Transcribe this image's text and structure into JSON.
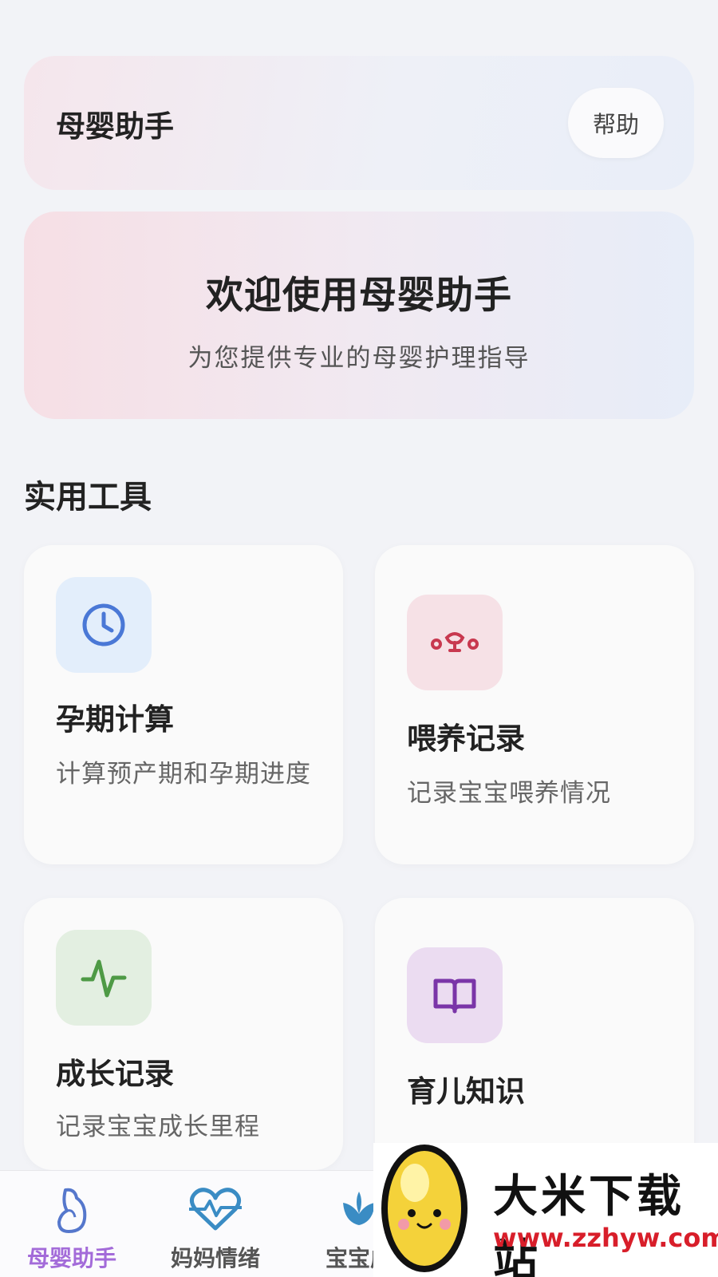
{
  "header": {
    "title": "母婴助手",
    "help_label": "帮助"
  },
  "banner": {
    "title": "欢迎使用母婴助手",
    "subtitle": "为您提供专业的母婴护理指导"
  },
  "tools": {
    "section_title": "实用工具",
    "items": [
      {
        "title": "孕期计算",
        "desc": "计算预产期和孕期进度",
        "icon": "clock-icon",
        "icon_bg": "#e3eefb",
        "icon_color": "#4a78d6"
      },
      {
        "title": "喂养记录",
        "desc": "记录宝宝喂养情况",
        "icon": "feeding-icon",
        "icon_bg": "#f6e1e6",
        "icon_color": "#c8384f"
      },
      {
        "title": "成长记录",
        "desc": "记录宝宝成长里程",
        "icon": "pulse-icon",
        "icon_bg": "#e3efe1",
        "icon_color": "#4e9a45"
      },
      {
        "title": "育儿知识",
        "desc": "",
        "icon": "book-icon",
        "icon_bg": "#ebdcf1",
        "icon_color": "#7a35a8"
      }
    ]
  },
  "bottom_nav": {
    "items": [
      {
        "label": "母婴助手",
        "icon": "pregnant-icon",
        "active": true
      },
      {
        "label": "妈妈情绪",
        "icon": "heart-pulse-icon",
        "active": false
      },
      {
        "label": "宝宝成",
        "icon": "lotus-icon",
        "active": false
      }
    ],
    "active_color": "#a36bd9"
  },
  "watermark": {
    "title": "大米下载站",
    "url": "www.zzhyw.com",
    "icon": "rice-mascot-icon"
  }
}
